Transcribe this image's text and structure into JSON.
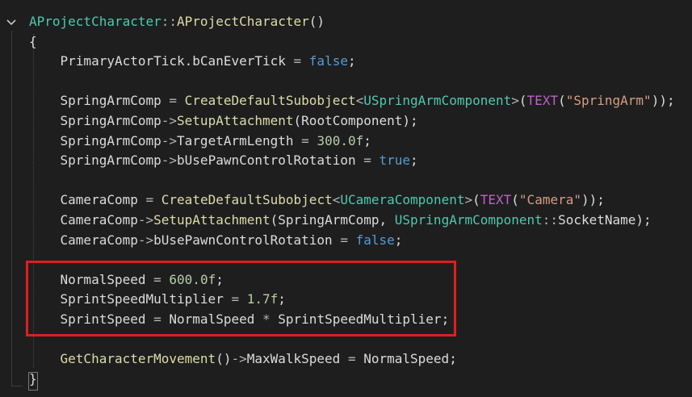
{
  "editor": {
    "colors": {
      "background": "#1e1e1e",
      "type": "#4ec9b0",
      "function": "#dcdcaa",
      "keyword": "#569cd6",
      "number": "#b5cea8",
      "string": "#d69d85",
      "macro": "#bd63c5",
      "identifier": "#dcdcdc",
      "highlight_box": "#e11d1d"
    },
    "fold_icon": "chevron-down-icon",
    "lines": [
      [
        {
          "c": "type",
          "t": "AProjectCharacter"
        },
        {
          "c": "op",
          "t": "::"
        },
        {
          "c": "func",
          "t": "AProjectCharacter"
        },
        {
          "c": "punct",
          "t": "()"
        }
      ],
      [
        {
          "c": "punct",
          "t": "{"
        }
      ],
      [
        {
          "c": "ident",
          "t": "    PrimaryActorTick.bCanEverTick "
        },
        {
          "c": "op",
          "t": "="
        },
        {
          "c": "ident",
          "t": " "
        },
        {
          "c": "kw",
          "t": "false"
        },
        {
          "c": "punct",
          "t": ";"
        }
      ],
      [],
      [
        {
          "c": "ident",
          "t": "    SpringArmComp "
        },
        {
          "c": "op",
          "t": "="
        },
        {
          "c": "ident",
          "t": " "
        },
        {
          "c": "func",
          "t": "CreateDefaultSubobject"
        },
        {
          "c": "op",
          "t": "<"
        },
        {
          "c": "type",
          "t": "USpringArmComponent"
        },
        {
          "c": "op",
          "t": ">"
        },
        {
          "c": "punct",
          "t": "("
        },
        {
          "c": "macro",
          "t": "TEXT"
        },
        {
          "c": "punct",
          "t": "("
        },
        {
          "c": "str",
          "t": "\"SpringArm\""
        },
        {
          "c": "punct",
          "t": "));"
        }
      ],
      [
        {
          "c": "ident",
          "t": "    SpringArmComp"
        },
        {
          "c": "op",
          "t": "->"
        },
        {
          "c": "func",
          "t": "SetupAttachment"
        },
        {
          "c": "punct",
          "t": "("
        },
        {
          "c": "ident",
          "t": "RootComponent"
        },
        {
          "c": "punct",
          "t": ");"
        }
      ],
      [
        {
          "c": "ident",
          "t": "    SpringArmComp"
        },
        {
          "c": "op",
          "t": "->"
        },
        {
          "c": "ident",
          "t": "TargetArmLength "
        },
        {
          "c": "op",
          "t": "="
        },
        {
          "c": "ident",
          "t": " "
        },
        {
          "c": "num",
          "t": "300.0f"
        },
        {
          "c": "punct",
          "t": ";"
        }
      ],
      [
        {
          "c": "ident",
          "t": "    SpringArmComp"
        },
        {
          "c": "op",
          "t": "->"
        },
        {
          "c": "ident",
          "t": "bUsePawnControlRotation "
        },
        {
          "c": "op",
          "t": "="
        },
        {
          "c": "ident",
          "t": " "
        },
        {
          "c": "kw",
          "t": "true"
        },
        {
          "c": "punct",
          "t": ";"
        }
      ],
      [],
      [
        {
          "c": "ident",
          "t": "    CameraComp "
        },
        {
          "c": "op",
          "t": "="
        },
        {
          "c": "ident",
          "t": " "
        },
        {
          "c": "func",
          "t": "CreateDefaultSubobject"
        },
        {
          "c": "op",
          "t": "<"
        },
        {
          "c": "type",
          "t": "UCameraComponent"
        },
        {
          "c": "op",
          "t": ">"
        },
        {
          "c": "punct",
          "t": "("
        },
        {
          "c": "macro",
          "t": "TEXT"
        },
        {
          "c": "punct",
          "t": "("
        },
        {
          "c": "str",
          "t": "\"Camera\""
        },
        {
          "c": "punct",
          "t": "));"
        }
      ],
      [
        {
          "c": "ident",
          "t": "    CameraComp"
        },
        {
          "c": "op",
          "t": "->"
        },
        {
          "c": "func",
          "t": "SetupAttachment"
        },
        {
          "c": "punct",
          "t": "("
        },
        {
          "c": "ident",
          "t": "SpringArmComp, "
        },
        {
          "c": "type",
          "t": "USpringArmComponent"
        },
        {
          "c": "op",
          "t": "::"
        },
        {
          "c": "ident",
          "t": "SocketName"
        },
        {
          "c": "punct",
          "t": ");"
        }
      ],
      [
        {
          "c": "ident",
          "t": "    CameraComp"
        },
        {
          "c": "op",
          "t": "->"
        },
        {
          "c": "ident",
          "t": "bUsePawnControlRotation "
        },
        {
          "c": "op",
          "t": "="
        },
        {
          "c": "ident",
          "t": " "
        },
        {
          "c": "kw",
          "t": "false"
        },
        {
          "c": "punct",
          "t": ";"
        }
      ],
      [],
      [
        {
          "c": "ident",
          "t": "    NormalSpeed "
        },
        {
          "c": "op",
          "t": "="
        },
        {
          "c": "ident",
          "t": " "
        },
        {
          "c": "num",
          "t": "600.0f"
        },
        {
          "c": "punct",
          "t": ";"
        }
      ],
      [
        {
          "c": "ident",
          "t": "    SprintSpeedMultiplier "
        },
        {
          "c": "op",
          "t": "="
        },
        {
          "c": "ident",
          "t": " "
        },
        {
          "c": "num",
          "t": "1.7f"
        },
        {
          "c": "punct",
          "t": ";"
        }
      ],
      [
        {
          "c": "ident",
          "t": "    SprintSpeed "
        },
        {
          "c": "op",
          "t": "="
        },
        {
          "c": "ident",
          "t": " NormalSpeed "
        },
        {
          "c": "op",
          "t": "*"
        },
        {
          "c": "ident",
          "t": " SprintSpeedMultiplier"
        },
        {
          "c": "punct",
          "t": ";"
        }
      ],
      [],
      [
        {
          "c": "ident",
          "t": "    "
        },
        {
          "c": "func",
          "t": "GetCharacterMovement"
        },
        {
          "c": "punct",
          "t": "()"
        },
        {
          "c": "op",
          "t": "->"
        },
        {
          "c": "ident",
          "t": "MaxWalkSpeed "
        },
        {
          "c": "op",
          "t": "="
        },
        {
          "c": "ident",
          "t": " NormalSpeed"
        },
        {
          "c": "punct",
          "t": ";"
        }
      ],
      [
        {
          "c": "punct",
          "t": "}"
        }
      ]
    ]
  }
}
